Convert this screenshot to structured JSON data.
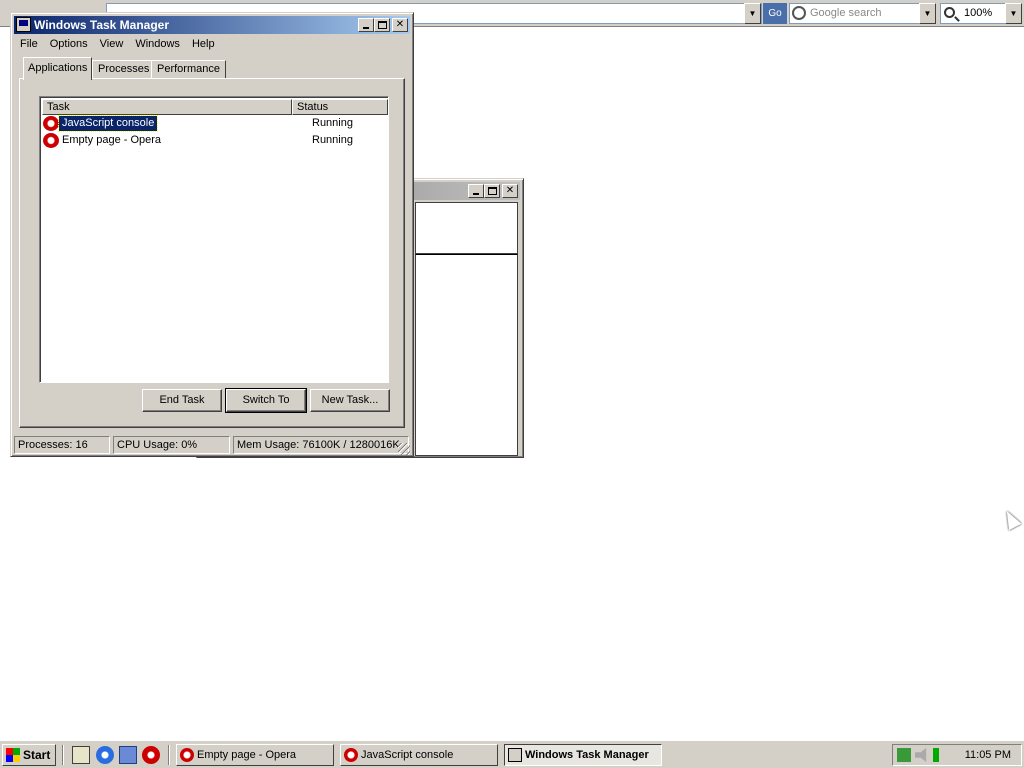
{
  "browser_toolbar": {
    "go_label": "Go",
    "search_placeholder": "Google search",
    "zoom_value": "100%"
  },
  "task_manager": {
    "title": "Windows Task Manager",
    "menu": [
      "File",
      "Options",
      "View",
      "Windows",
      "Help"
    ],
    "tabs": [
      "Applications",
      "Processes",
      "Performance"
    ],
    "active_tab": "Applications",
    "columns": {
      "task": "Task",
      "status": "Status"
    },
    "tasks": [
      {
        "name": "JavaScript console",
        "status": "Running",
        "selected": true
      },
      {
        "name": "Empty page - Opera",
        "status": "Running",
        "selected": false
      }
    ],
    "buttons": {
      "end_task": "End Task",
      "switch_to": "Switch To",
      "new_task": "New Task..."
    },
    "status": {
      "processes": "Processes: 16",
      "cpu": "CPU Usage: 0%",
      "mem": "Mem Usage: 76100K / 1280016K"
    }
  },
  "taskbar": {
    "start_label": "Start",
    "buttons": [
      {
        "label": "Empty page - Opera"
      },
      {
        "label": "JavaScript console"
      },
      {
        "label": "Windows Task Manager",
        "active": true
      }
    ],
    "clock": "11:05 PM"
  }
}
